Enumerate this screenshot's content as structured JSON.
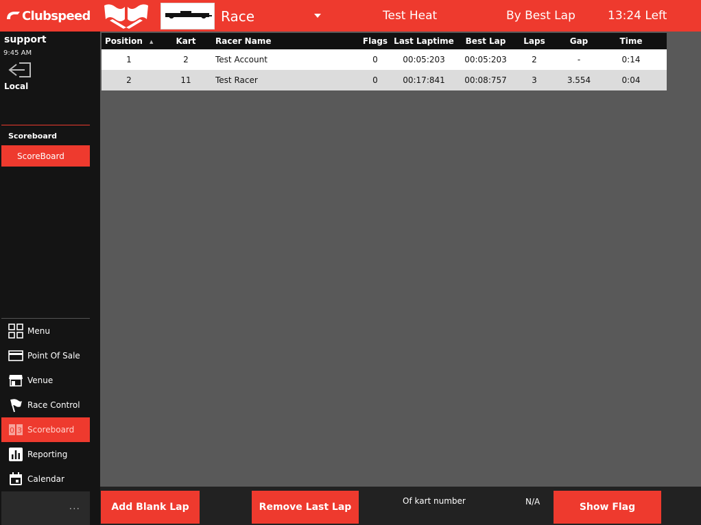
{
  "header": {
    "logo_text": "Clubspeed",
    "race_label": "Race",
    "heat_name": "Test Heat",
    "sort_mode": "By Best Lap",
    "time_left": "13:24 Left"
  },
  "sidebar": {
    "user": "support",
    "time": "9:45 AM",
    "location": "Local",
    "section_heading": "Scoreboard",
    "section_tab": "ScoreBoard",
    "nav": [
      {
        "label": "Menu",
        "icon": "grid-icon",
        "active": false
      },
      {
        "label": "Point Of Sale",
        "icon": "credit-card-icon",
        "active": false
      },
      {
        "label": "Venue",
        "icon": "store-icon",
        "active": false
      },
      {
        "label": "Race Control",
        "icon": "flag-icon",
        "active": false
      },
      {
        "label": "Scoreboard",
        "icon": "scoreboard-icon",
        "active": true
      },
      {
        "label": "Reporting",
        "icon": "bar-chart-icon",
        "active": false
      },
      {
        "label": "Calendar",
        "icon": "calendar-icon",
        "active": false
      }
    ],
    "more": "..."
  },
  "table": {
    "columns": [
      "Position",
      "Kart",
      "Racer Name",
      "Flags",
      "Last Laptime",
      "Best Lap",
      "Laps",
      "Gap",
      "Time"
    ],
    "sort_indicator": "▲",
    "rows": [
      [
        "1",
        "2",
        "Test Account",
        "0",
        "00:05:203",
        "00:05:203",
        "2",
        "-",
        "0:14"
      ],
      [
        "2",
        "11",
        "Test Racer",
        "0",
        "00:17:841",
        "00:08:757",
        "3",
        "3.554",
        "0:04"
      ]
    ]
  },
  "footer": {
    "add_lap": "Add Blank Lap",
    "remove_lap": "Remove Last Lap",
    "kart_label": "Of kart number",
    "kart_value": "N/A",
    "show_flag": "Show Flag"
  },
  "colors": {
    "accent": "#ee3a2e",
    "sidebar_bg": "#141414",
    "main_bg": "#595959"
  }
}
